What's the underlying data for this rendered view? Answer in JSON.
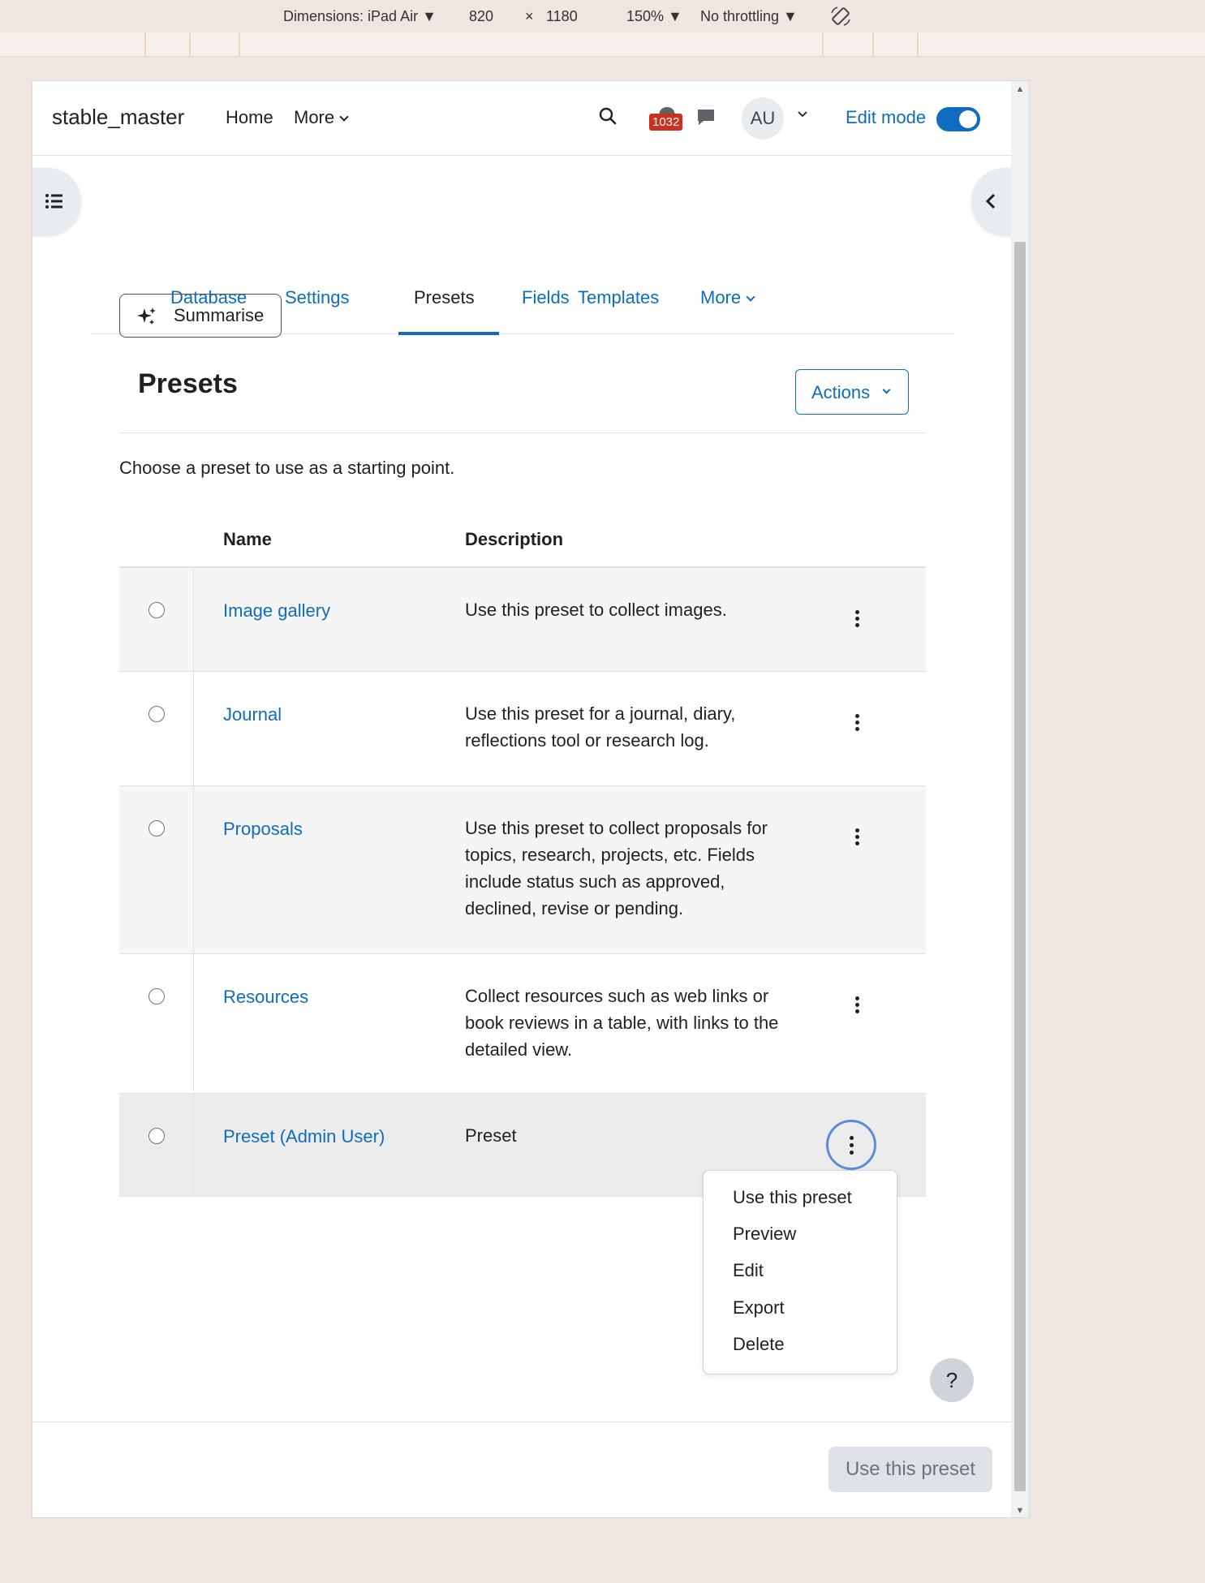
{
  "devtools": {
    "dimensions": "Dimensions: iPad Air ▼",
    "width": "820",
    "times": "×",
    "height": "1180",
    "zoom": "150% ▼",
    "throttling": "No throttling ▼"
  },
  "navbar": {
    "brand": "stable_master",
    "home": "Home",
    "more": "More",
    "notification_count": "1032",
    "avatar_initials": "AU",
    "edit_mode_label": "Edit mode",
    "edit_mode_on": true
  },
  "tabs": [
    {
      "label": "Database",
      "active": false
    },
    {
      "label": "Settings",
      "active": false
    },
    {
      "label": "Presets",
      "active": true
    },
    {
      "label": "Fields",
      "active": false
    },
    {
      "label": "Templates",
      "active": false
    },
    {
      "label": "More",
      "active": false
    }
  ],
  "content": {
    "summarise_label": "Summarise",
    "title": "Presets",
    "actions_label": "Actions",
    "intro": "Choose a preset to use as a starting point.",
    "table": {
      "headers": {
        "name": "Name",
        "description": "Description"
      },
      "rows": [
        {
          "name": "Image gallery",
          "description": "Use this preset to collect images."
        },
        {
          "name": "Journal",
          "description": "Use this preset for a journal, diary, reflections tool or research log."
        },
        {
          "name": "Proposals",
          "description": "Use this preset to collect proposals for topics, research, projects, etc. Fields include status such as approved, declined, revise or pending."
        },
        {
          "name": "Resources",
          "description": "Collect resources such as web links or book reviews in a table, with links to the detailed view."
        },
        {
          "name": "Preset (Admin User)",
          "description": "Preset"
        }
      ]
    },
    "row_menu": [
      "Use this preset",
      "Preview",
      "Edit",
      "Export",
      "Delete"
    ]
  },
  "help_label": "?",
  "footer": {
    "use_button": "Use this preset"
  },
  "colors": {
    "link": "#0f6cbf",
    "badge": "#ca3120",
    "page_bg": "#efe6e1"
  }
}
